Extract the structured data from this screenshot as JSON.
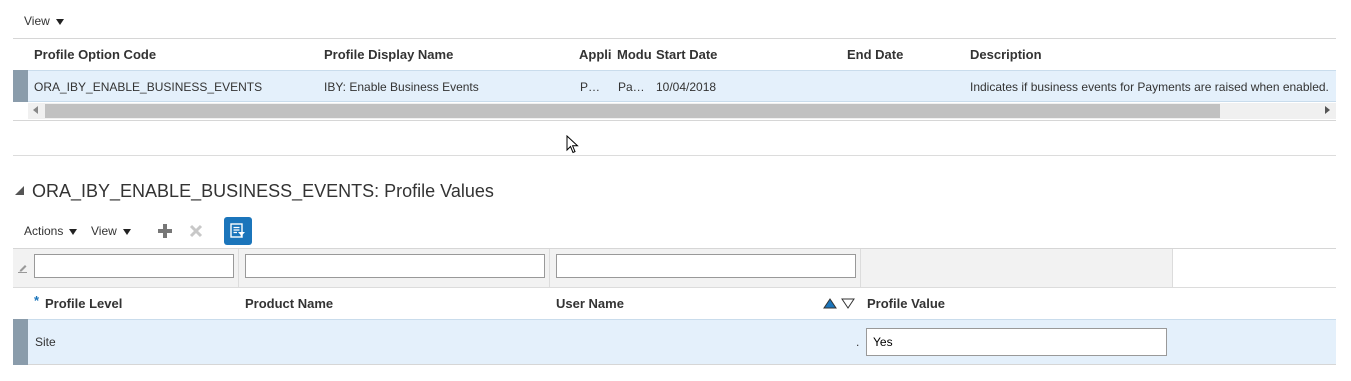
{
  "top_toolbar": {
    "view_label": "View"
  },
  "profiles_table": {
    "columns": {
      "code": "Profile Option Code",
      "display_name": "Profile Display Name",
      "application": "Appli",
      "module": "Modu",
      "start_date": "Start Date",
      "end_date": "End Date",
      "description": "Description"
    },
    "rows": [
      {
        "code": "ORA_IBY_ENABLE_BUSINESS_EVENTS",
        "display_name": "IBY: Enable Business Events",
        "application": "P…",
        "module": "Pa…",
        "start_date": "10/04/2018",
        "end_date": "",
        "description": "Indicates if business events for Payments are raised when enabled."
      }
    ]
  },
  "values_section": {
    "title": "ORA_IBY_ENABLE_BUSINESS_EVENTS: Profile Values",
    "toolbar": {
      "actions_label": "Actions",
      "view_label": "View"
    },
    "filter_inputs": {
      "profile_level": "",
      "product_name": "",
      "user_name": ""
    },
    "columns": {
      "required_marker": "*",
      "profile_level": "Profile Level",
      "product_name": "Product Name",
      "user_name": "User Name",
      "profile_value": "Profile Value"
    },
    "rows": [
      {
        "profile_level": "Site",
        "product_name": "",
        "user_name": ".",
        "profile_value": "Yes"
      }
    ]
  },
  "colors": {
    "selected_row": "#e4f0fb",
    "row_marker": "#8a9cab",
    "accent_button": "#1b75bb",
    "filter_bar": "#f2f2f2"
  },
  "icons": [
    "chevron-down-icon",
    "collapse-triangle-icon",
    "add-icon",
    "delete-icon",
    "query-by-example-icon",
    "edit-pencil-icon",
    "sort-ascending-icon",
    "sort-descending-icon",
    "scroll-left-icon",
    "scroll-right-icon",
    "mouse-cursor-icon"
  ]
}
